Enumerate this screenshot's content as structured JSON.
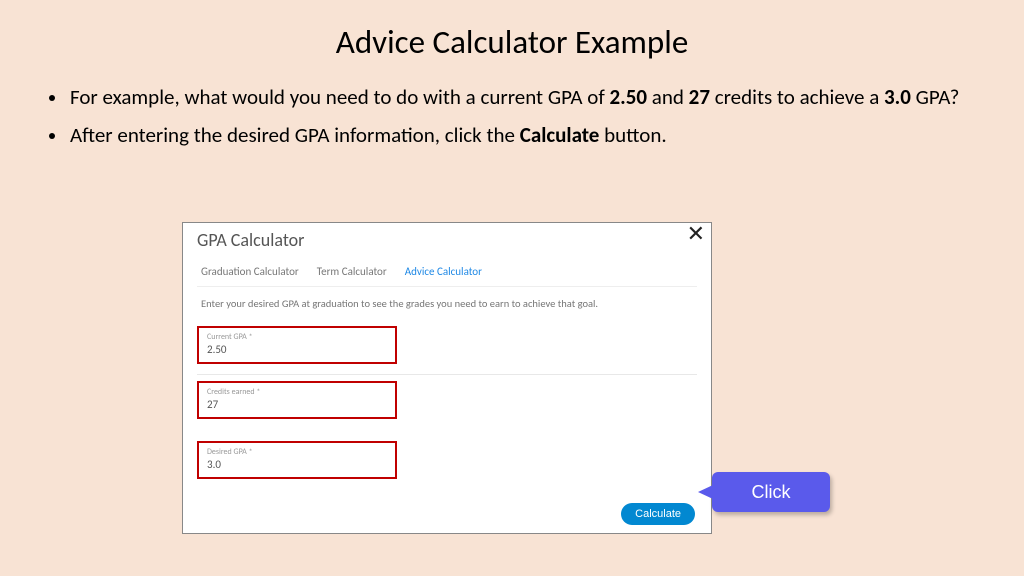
{
  "title": "Advice Calculator Example",
  "bullets": [
    {
      "pre": "For example, what would you need to do with a current GPA of ",
      "b1": "2.50",
      "mid1": " and ",
      "b2": "27",
      "mid2": " credits to achieve a ",
      "b3": "3.0",
      "post": " GPA?"
    },
    {
      "pre": "After entering the desired GPA information, click the ",
      "b1": "Calculate",
      "post": " button."
    }
  ],
  "panel": {
    "title": "GPA Calculator",
    "close": "✕",
    "tabs": [
      "Graduation Calculator",
      "Term Calculator",
      "Advice Calculator"
    ],
    "hint": "Enter your desired GPA at graduation to see the grades you need to earn to achieve that goal.",
    "fields": [
      {
        "label": "Current GPA *",
        "value": "2.50"
      },
      {
        "label": "Credits earned *",
        "value": "27"
      },
      {
        "label": "Desired GPA *",
        "value": "3.0"
      }
    ],
    "button": "Calculate"
  },
  "callout": "Click"
}
